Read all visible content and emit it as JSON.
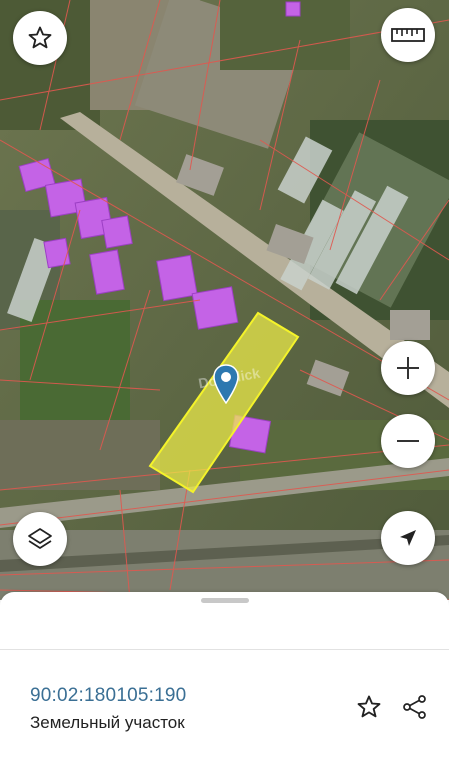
{
  "map": {
    "type": "satellite-cadastral",
    "selected_parcel_color": "#f0ef4a",
    "building_highlight_color": "#c463e6",
    "boundary_line_color": "#e0584f",
    "controls": {
      "favorite": "star-outline-icon",
      "ruler": "ruler-icon",
      "zoom_in": "plus-icon",
      "zoom_out": "minus-icon",
      "layers": "layers-icon",
      "locate": "navigation-arrow-icon"
    },
    "watermark": "Domclick"
  },
  "bottom_sheet": {
    "cadastral_number": "90:02:180105:190",
    "object_type": "Земельный участок",
    "actions": {
      "favorite": "star-outline-icon",
      "share": "share-icon"
    },
    "accent_color": "#3a6f94"
  }
}
